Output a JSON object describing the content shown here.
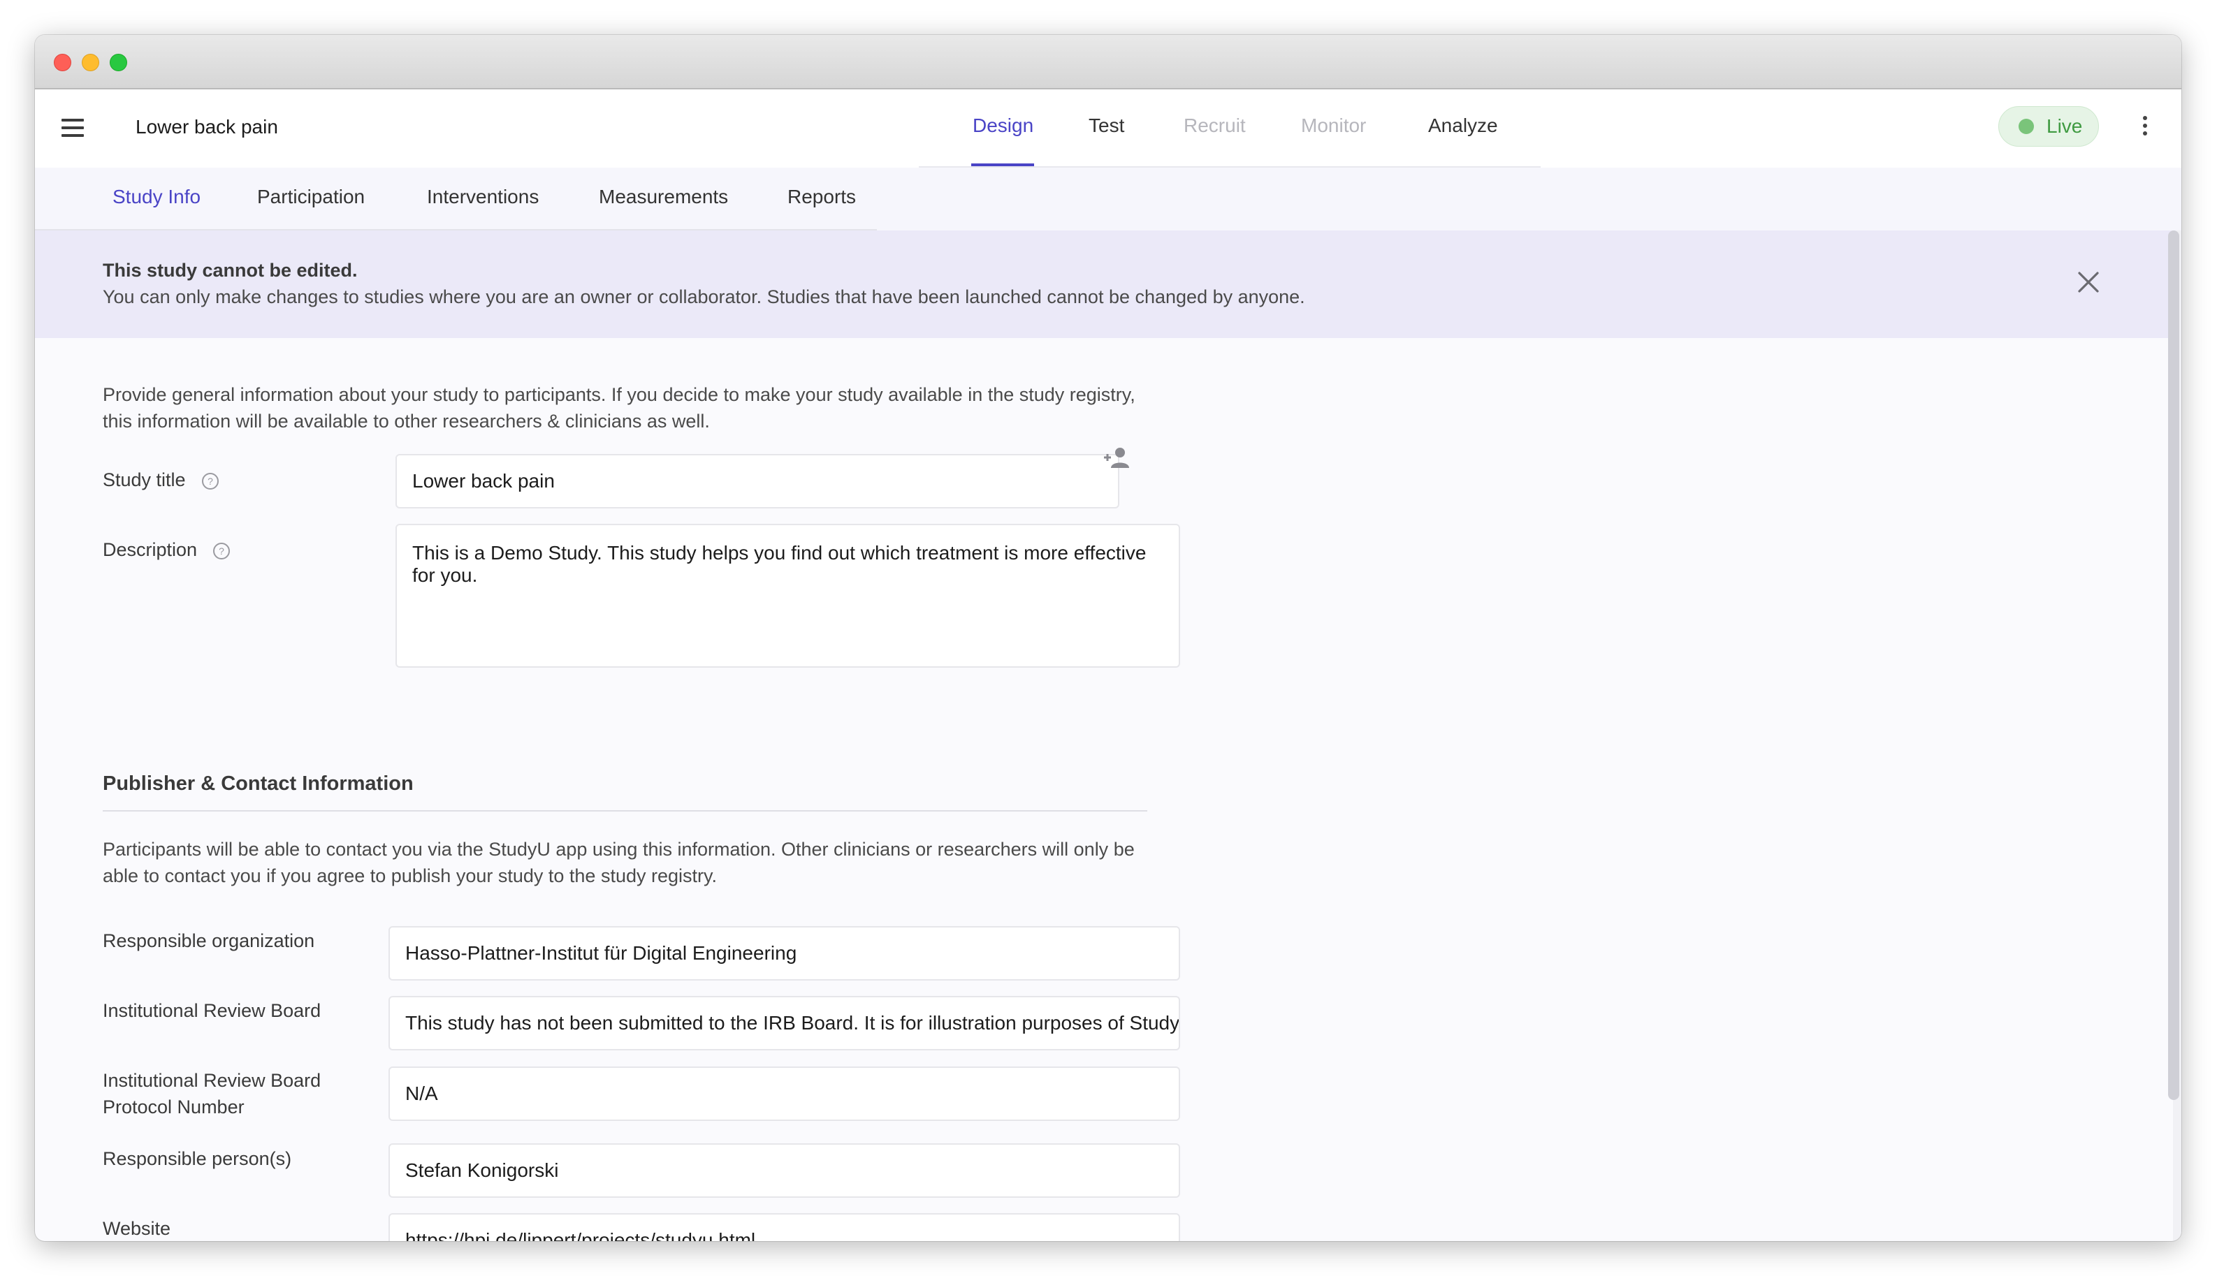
{
  "window": {
    "controls": [
      "close",
      "minimize",
      "maximize"
    ]
  },
  "appbar": {
    "menu_icon": "menu-icon",
    "title": "Lower back pain",
    "tabs": [
      {
        "label": "Design",
        "state": "active"
      },
      {
        "label": "Test",
        "state": "normal"
      },
      {
        "label": "Recruit",
        "state": "disabled"
      },
      {
        "label": "Monitor",
        "state": "disabled"
      },
      {
        "label": "Analyze",
        "state": "normal"
      }
    ],
    "status": {
      "label": "Live",
      "color": "#7ac47a"
    },
    "more_icon": "more-vertical-icon"
  },
  "subtabs": [
    {
      "label": "Study Info",
      "active": true
    },
    {
      "label": "Participation",
      "active": false
    },
    {
      "label": "Interventions",
      "active": false
    },
    {
      "label": "Measurements",
      "active": false
    },
    {
      "label": "Reports",
      "active": false
    }
  ],
  "banner": {
    "title": "This study cannot be edited.",
    "text": "You can only make changes to studies where you are an owner or collaborator. Studies that have been launched cannot be changed by anyone.",
    "close_icon": "close-icon"
  },
  "form": {
    "intro": "Provide general information about your study to participants. If you decide to make your study available in the study registry, this information will be available to other researchers & clinicians as well.",
    "study_title": {
      "label": "Study title",
      "value": "Lower back pain"
    },
    "description": {
      "label": "Description",
      "value": "This is a Demo Study. This study helps you find out which treatment is more effective for you."
    },
    "publisher": {
      "section_title": "Publisher & Contact Information",
      "intro": "Participants will be able to contact you via the StudyU app using this information. Other clinicians or researchers will only be able to contact you if you agree to publish your study to the study registry.",
      "fields": [
        {
          "label": "Responsible organization",
          "value": "Hasso-Plattner-Institut für Digital Engineering"
        },
        {
          "label": "Institutional Review Board",
          "value": "This study has not been submitted to the IRB Board. It is for illustration purposes of StudyU only."
        },
        {
          "label": "Institutional Review Board Protocol Number",
          "value": "N/A"
        },
        {
          "label": "Responsible person(s)",
          "value": "Stefan Konigorski"
        },
        {
          "label": "Website",
          "value": "https://hpi.de/lippert/projects/studyu.html"
        }
      ]
    }
  },
  "colors": {
    "accent": "#4a44c6",
    "banner_bg": "#ebe9f8",
    "live_bg": "#e6f4e6"
  }
}
